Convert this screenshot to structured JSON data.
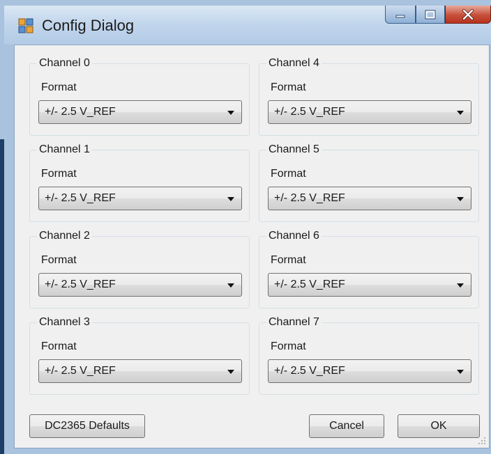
{
  "window": {
    "title": "Config Dialog",
    "caption_buttons": {
      "minimize_icon": "minimize-icon",
      "maximize_icon": "maximize-icon",
      "close_icon": "close-icon"
    }
  },
  "channels": [
    {
      "name": "Channel 0",
      "format_label": "Format",
      "format_value": "+/- 2.5 V_REF"
    },
    {
      "name": "Channel 1",
      "format_label": "Format",
      "format_value": "+/- 2.5 V_REF"
    },
    {
      "name": "Channel 2",
      "format_label": "Format",
      "format_value": "+/- 2.5 V_REF"
    },
    {
      "name": "Channel 3",
      "format_label": "Format",
      "format_value": "+/- 2.5 V_REF"
    },
    {
      "name": "Channel 4",
      "format_label": "Format",
      "format_value": "+/- 2.5 V_REF"
    },
    {
      "name": "Channel 5",
      "format_label": "Format",
      "format_value": "+/- 2.5 V_REF"
    },
    {
      "name": "Channel 6",
      "format_label": "Format",
      "format_value": "+/- 2.5 V_REF"
    },
    {
      "name": "Channel 7",
      "format_label": "Format",
      "format_value": "+/- 2.5 V_REF"
    }
  ],
  "buttons": {
    "defaults": "DC2365 Defaults",
    "cancel": "Cancel",
    "ok": "OK"
  },
  "colors": {
    "close_button": "#c74f3a",
    "window_frame": "#a9c2dd",
    "client_background": "#f0f0f0"
  }
}
